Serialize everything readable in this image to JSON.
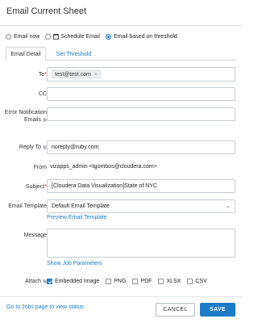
{
  "dialog": {
    "title": "Email Current Sheet"
  },
  "mode": {
    "options": [
      {
        "label": "Email now",
        "checked": false
      },
      {
        "label": "Schedule Email",
        "checked": false,
        "icon": "calendar-icon"
      },
      {
        "label": "Email based on threshold",
        "checked": true
      }
    ]
  },
  "tabs": [
    {
      "label": "Email Detail",
      "active": true
    },
    {
      "label": "Set Threshold",
      "active": false
    }
  ],
  "form": {
    "to_label": "To",
    "to_chip": "test@test.com",
    "to_chip_remove": "×",
    "cc_label": "CC",
    "error_label": "Error Notification Emails",
    "reply_to_label": "Reply To",
    "reply_to_value": "noreply@ruby.com",
    "from_label": "From",
    "from_value": "vizapps_admin <tgombos@cloudera.com>",
    "subject_label": "Subject",
    "subject_value": "[Cloudera Data Visualization]State of NYC",
    "template_label": "Email Template",
    "template_value": "Default Email Template",
    "preview_link": "Preview Email Template",
    "message_label": "Message",
    "job_params_link": "Show Job Parameters",
    "attach_label": "Attach",
    "attach_options": [
      {
        "label": "Embedded Image",
        "checked": true
      },
      {
        "label": "PNG",
        "checked": false
      },
      {
        "label": "PDF",
        "checked": false
      },
      {
        "label": "XLSX",
        "checked": false
      },
      {
        "label": "CSV",
        "checked": false
      }
    ],
    "required_marker": "*"
  },
  "footer": {
    "status_link": "Go to Jobs page to view status",
    "cancel_label": "CANCEL",
    "save_label": "SAVE"
  },
  "colors": {
    "accent": "#1c7cc8",
    "required": "#d0322a"
  }
}
